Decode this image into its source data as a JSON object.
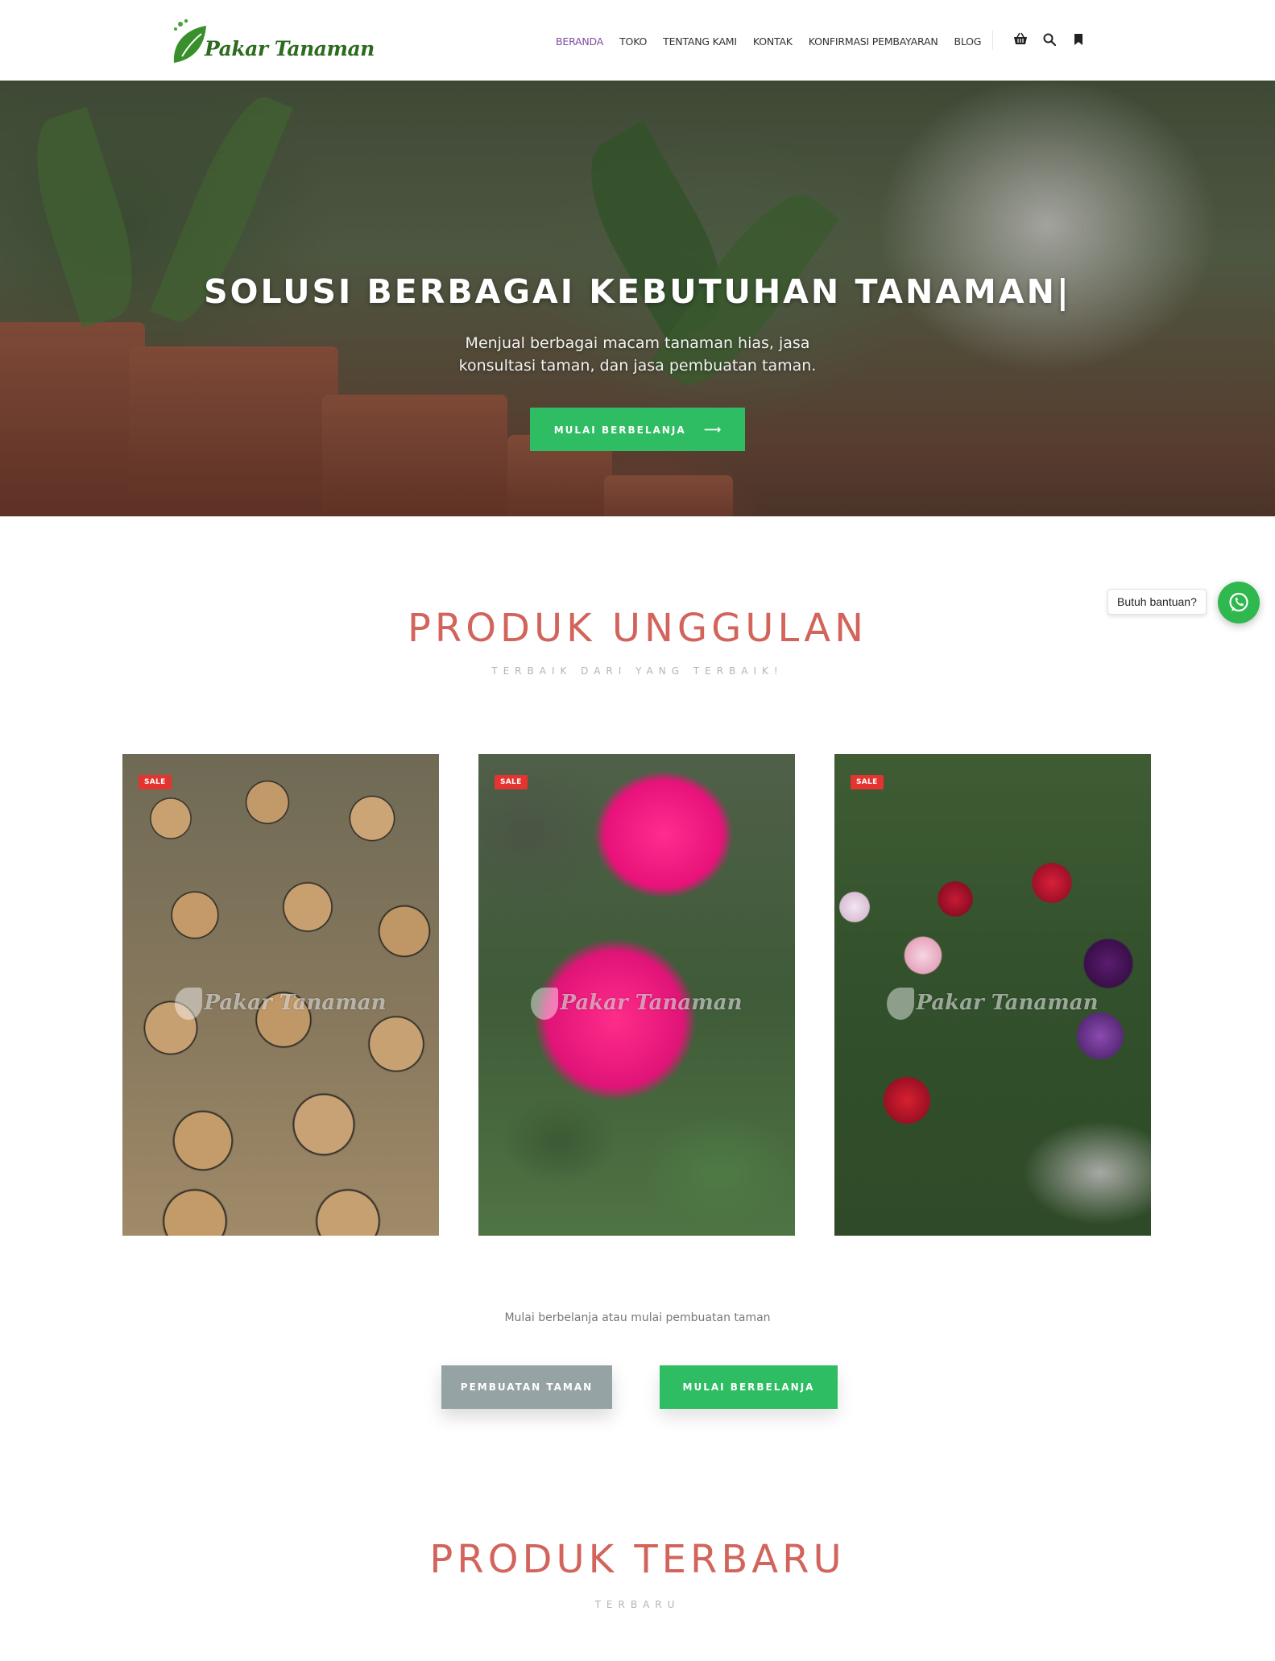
{
  "header": {
    "logo_text": "Pakar Tanaman",
    "nav": [
      {
        "label": "BERANDA",
        "active": true
      },
      {
        "label": "TOKO",
        "active": false
      },
      {
        "label": "TENTANG KAMI",
        "active": false
      },
      {
        "label": "KONTAK",
        "active": false
      },
      {
        "label": "KONFIRMASI PEMBAYARAN",
        "active": false
      },
      {
        "label": "BLOG",
        "active": false
      }
    ],
    "icons": [
      "basket-icon",
      "search-icon",
      "bookmark-icon"
    ]
  },
  "hero": {
    "title": "SOLUSI BERBAGAI KEBUTUHAN TANAMAN|",
    "subtitle_line1": "Menjual berbagai macam tanaman hias, jasa",
    "subtitle_line2": "konsultasi taman, dan jasa pembuatan taman.",
    "button_label": "MULAI BERBELANJA",
    "button_arrow": "⟶"
  },
  "featured": {
    "title": "PRODUK UNGGULAN",
    "subtitle": "TERBAIK DARI YANG TERBAIK!",
    "products": [
      {
        "badge": "SALE",
        "watermark": "Pakar Tanaman"
      },
      {
        "badge": "SALE",
        "watermark": "Pakar Tanaman"
      },
      {
        "badge": "SALE",
        "watermark": "Pakar Tanaman"
      }
    ]
  },
  "cta": {
    "text": "Mulai berbelanja atau mulai pembuatan taman",
    "garden_button": "PEMBUATAN TAMAN",
    "shop_button": "MULAI BERBELANJA"
  },
  "latest": {
    "title": "PRODUK TERBARU",
    "subtitle": "TERBARU"
  },
  "whatsapp": {
    "bubble_text": "Butuh bantuan?"
  },
  "colors": {
    "accent_green": "#2ebd62",
    "section_title": "#d2645c",
    "nav_active": "#7e4e9e",
    "sale_badge": "#e3342f",
    "button_grey": "#95a3a4"
  }
}
